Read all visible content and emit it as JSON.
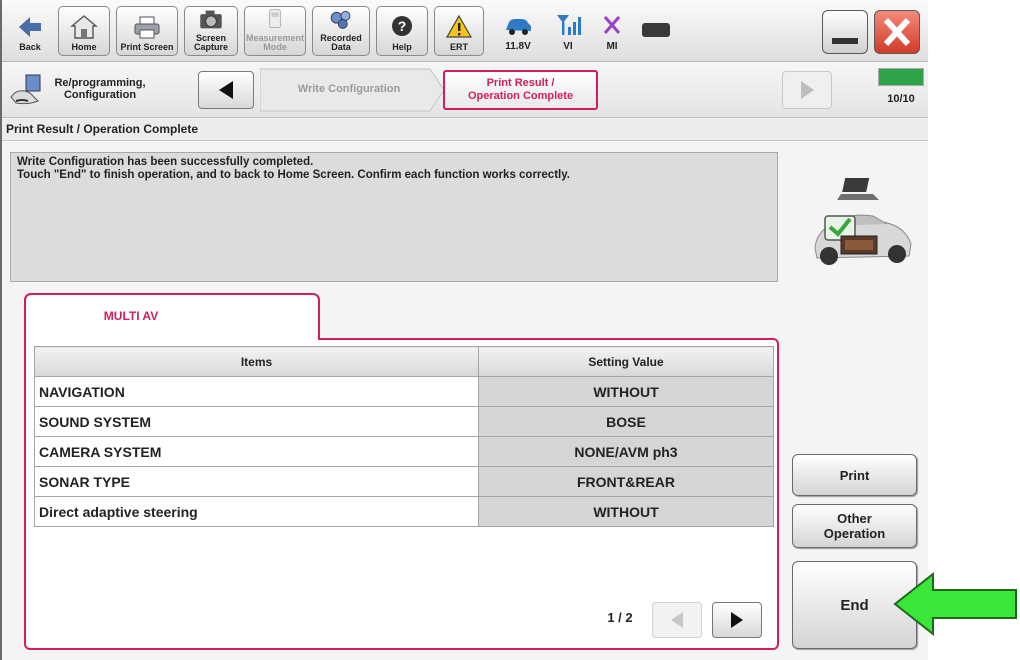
{
  "toolbar": {
    "back": "Back",
    "home": "Home",
    "print_screen": "Print Screen",
    "screen_capture": "Screen\nCapture",
    "measurement_mode": "Measurement\nMode",
    "recorded_data": "Recorded\nData",
    "help": "Help",
    "ert": "ERT",
    "battery_voltage": "11.8V",
    "vi": "VI",
    "mi": "MI"
  },
  "workflow": {
    "section_label": "Re/programming,\nConfiguration",
    "previous_step": "Write Configuration",
    "current_step": "Print Result /\nOperation Complete",
    "progress_text": "10/10",
    "progress_fraction": 1.0
  },
  "page_title": "Print Result / Operation Complete",
  "message": {
    "line1": "Write Configuration has been successfully completed.",
    "line2": "Touch \"End\" to finish operation, and to back to Home Screen. Confirm each function works correctly."
  },
  "tab": {
    "label": "MULTI AV"
  },
  "table": {
    "headers": {
      "items": "Items",
      "setting_value": "Setting Value"
    },
    "rows": [
      {
        "item": "NAVIGATION",
        "value": "WITHOUT"
      },
      {
        "item": "SOUND SYSTEM",
        "value": "BOSE"
      },
      {
        "item": "CAMERA SYSTEM",
        "value": "NONE/AVM ph3"
      },
      {
        "item": "SONAR TYPE",
        "value": "FRONT&REAR"
      },
      {
        "item": "Direct adaptive steering",
        "value": "WITHOUT"
      }
    ]
  },
  "pager": {
    "page": "1 / 2"
  },
  "buttons": {
    "print": "Print",
    "other_operation": "Other\nOperation",
    "end": "End"
  },
  "colors": {
    "accent": "#d21f5a",
    "callout": "#39e639",
    "progress": "#2ea34a",
    "close": "#e04a3a"
  }
}
